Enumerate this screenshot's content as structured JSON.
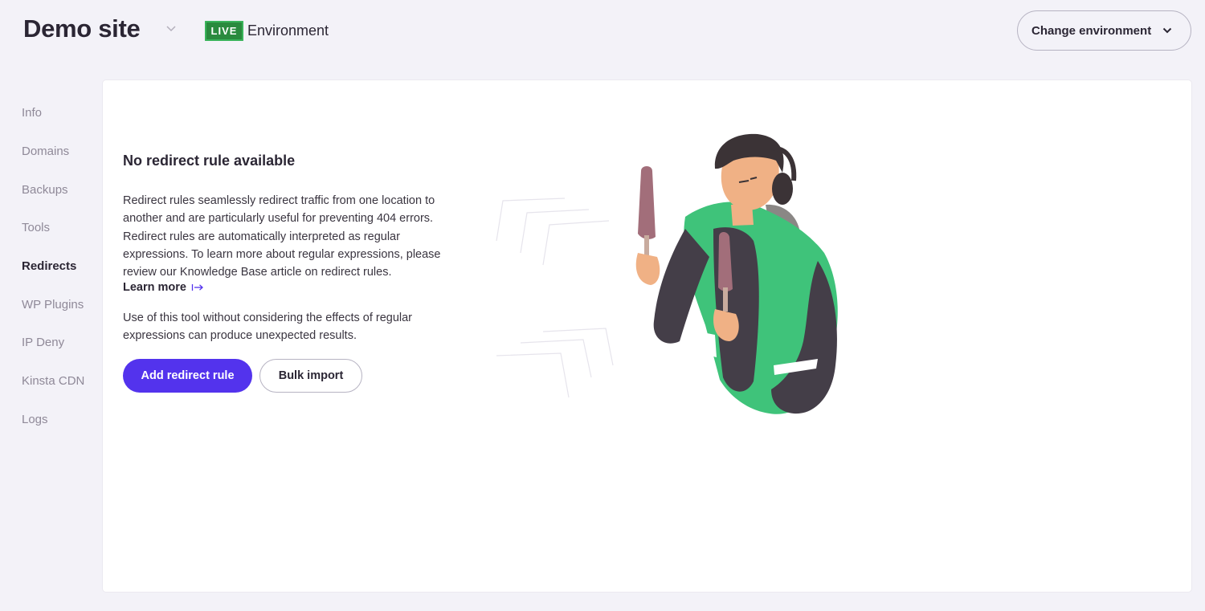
{
  "header": {
    "site_name": "Demo site",
    "env_badge": "LIVE",
    "env_label": "Environment",
    "change_env_label": "Change environment"
  },
  "sidebar": {
    "items": [
      {
        "label": "Info",
        "active": false
      },
      {
        "label": "Domains",
        "active": false
      },
      {
        "label": "Backups",
        "active": false
      },
      {
        "label": "Tools",
        "active": false
      },
      {
        "label": "Redirects",
        "active": true
      },
      {
        "label": "WP Plugins",
        "active": false
      },
      {
        "label": "IP Deny",
        "active": false
      },
      {
        "label": "Kinsta CDN",
        "active": false
      },
      {
        "label": "Logs",
        "active": false
      }
    ]
  },
  "main": {
    "title": "No redirect rule available",
    "description": "Redirect rules seamlessly redirect traffic from one location to another and are particularly useful for preventing 404 errors. Redirect rules are automatically interpreted as regular expressions. To learn more about regular expressions, please review our Knowledge Base article on redirect rules.",
    "learn_more": "Learn more",
    "warning": "Use of this tool without considering the effects of regular expressions can produce unexpected results.",
    "add_button": "Add redirect rule",
    "bulk_button": "Bulk import"
  },
  "icons": {
    "site_dropdown": "chevron-down-icon",
    "env_dropdown": "chevron-down-icon",
    "learn_more": "arrow-right-icon"
  },
  "colors": {
    "accent": "#5333ed",
    "live_badge": "#2a8a3e",
    "background": "#f3f2f8",
    "illustration_green": "#3fc37a"
  }
}
